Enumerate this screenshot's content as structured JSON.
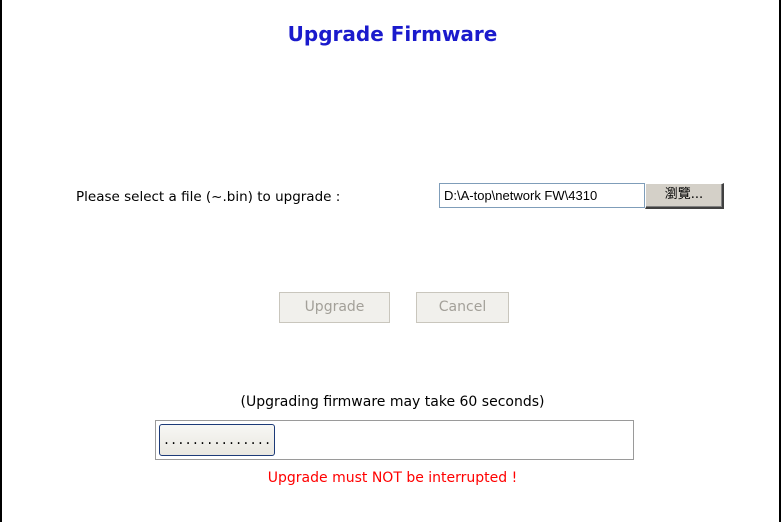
{
  "page": {
    "title": "Upgrade Firmware"
  },
  "file_select": {
    "label": "Please select a file (~.bin) to upgrade :",
    "value": "D:\\A-top\\network FW\\4310",
    "browse_label": "瀏覽..."
  },
  "actions": {
    "upgrade_label": "Upgrade",
    "cancel_label": "Cancel"
  },
  "status": {
    "note": "(Upgrading firmware may take 60 seconds)",
    "progress_text": "...............",
    "warning": "Upgrade must NOT be interrupted !"
  },
  "colors": {
    "title": "#1a1acc",
    "warning": "#ff0000",
    "button_face": "#d4d0c8",
    "disabled_text": "#a3a099"
  }
}
